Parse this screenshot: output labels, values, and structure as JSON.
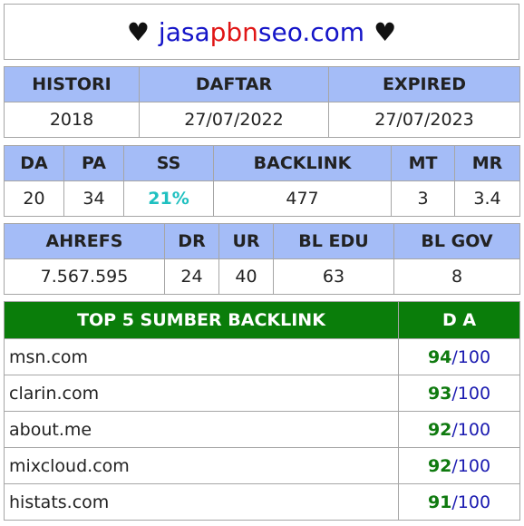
{
  "title": {
    "heart_left": "♥",
    "part1": "jasa",
    "part2": "pbn",
    "part3": "seo.com",
    "heart_right": "♥"
  },
  "histori_table": {
    "headers": [
      "HISTORI",
      "DAFTAR",
      "EXPIRED"
    ],
    "values": [
      "2018",
      "27/07/2022",
      "27/07/2023"
    ]
  },
  "metrics_table": {
    "headers": [
      "DA",
      "PA",
      "SS",
      "BACKLINK",
      "MT",
      "MR"
    ],
    "values": [
      "20",
      "34",
      "21%",
      "477",
      "3",
      "3.4"
    ]
  },
  "ahrefs_table": {
    "headers": [
      "AHREFS",
      "DR",
      "UR",
      "BL EDU",
      "BL GOV"
    ],
    "values": [
      "7.567.595",
      "24",
      "40",
      "63",
      "8"
    ]
  },
  "backlinks_table": {
    "headers": [
      "TOP 5 SUMBER BACKLINK",
      "D A"
    ],
    "separator": "/",
    "max": "100",
    "rows": [
      {
        "site": "msn.com",
        "da": "94"
      },
      {
        "site": "clarin.com",
        "da": "93"
      },
      {
        "site": "about.me",
        "da": "92"
      },
      {
        "site": "mixcloud.com",
        "da": "92"
      },
      {
        "site": "histats.com",
        "da": "91"
      }
    ]
  },
  "colors": {
    "header_blue": "#a4bcf7",
    "header_green": "#0a7d0a",
    "ss_teal": "#1fc0c0",
    "da_green": "#0f7a0f",
    "title_blue": "#1414c8",
    "title_red": "#e01616"
  }
}
